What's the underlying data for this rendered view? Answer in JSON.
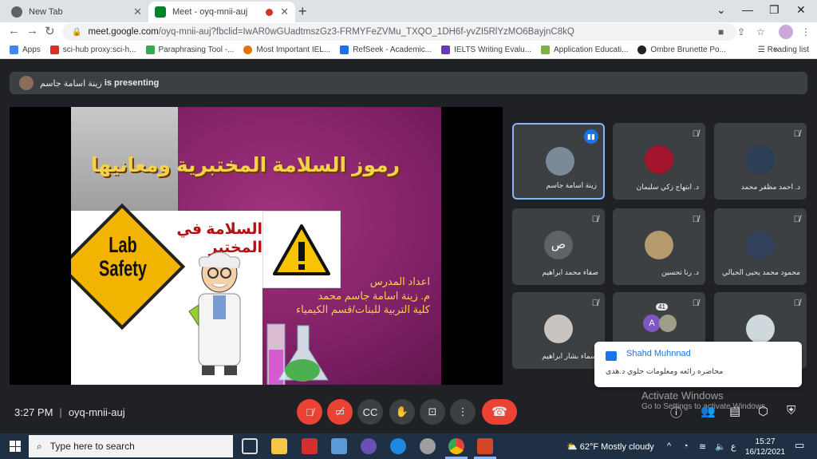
{
  "browser": {
    "tabs": [
      {
        "title": "New Tab"
      },
      {
        "title": "Meet - oyq-mnii-auj"
      }
    ],
    "url_host": "meet.google.com",
    "url_path": "/oyq-mnii-auj?fbclid=IwAR0wGUadtmszGz3-FRMYFeZVMu_TXQO_1DH6f-yvZI5RlYzMO6BayjnC8kQ",
    "bookmarks": [
      {
        "label": "Apps"
      },
      {
        "label": "sci-hub proxy:sci-h..."
      },
      {
        "label": "Paraphrasing Tool -..."
      },
      {
        "label": "Most Important IEL..."
      },
      {
        "label": "RefSeek - Academic..."
      },
      {
        "label": "IELTS Writing Evalu..."
      },
      {
        "label": "Application Educati..."
      },
      {
        "label": "Ombre Brunette Po..."
      }
    ],
    "reading_list": "Reading list"
  },
  "meet": {
    "presenter_name": "زينة اسامة جاسم",
    "presenting_suffix": "is presenting",
    "slide": {
      "title": "رموز السلامة المختبرية ومعانيها",
      "sign_line1": "Lab",
      "sign_line2": "Safety",
      "pic_title": "السلامة في المختبر",
      "credit_line1": "اعداد المدرس",
      "credit_line2": "م. زينة اسامة جاسم محمد",
      "credit_line3": "كلية التربية للبنات/قسم الكيمياء"
    },
    "participants": [
      {
        "name": "زينة اسامة جاسم",
        "speaking": true
      },
      {
        "name": "د. ابتهاج زكي سليمان"
      },
      {
        "name": "د. احمد مظفر محمد"
      },
      {
        "name": "صفاء محمد ابراهيم",
        "initial": "ص"
      },
      {
        "name": "د. رنا تحسين"
      },
      {
        "name": "محمود محمد يحيى الحيالي"
      },
      {
        "name": "اسماء بشار ابراهيم"
      },
      {
        "name": "",
        "initial": "A",
        "count": "41"
      },
      {
        "name": ""
      }
    ],
    "notification": {
      "name": "Shahd Muhnnad",
      "message": "محاضره رائعه ومعلومات حلوي د.هدى"
    },
    "time": "3:27 PM",
    "meeting_code": "oyq-mnii-auj",
    "watermark_line1": "Activate Windows",
    "watermark_line2": "Go to Settings to activate Windows."
  },
  "taskbar": {
    "search_placeholder": "Type here to search",
    "weather": "62°F  Mostly cloudy",
    "lang": "ع",
    "time": "15:27",
    "date": "16/12/2021"
  }
}
